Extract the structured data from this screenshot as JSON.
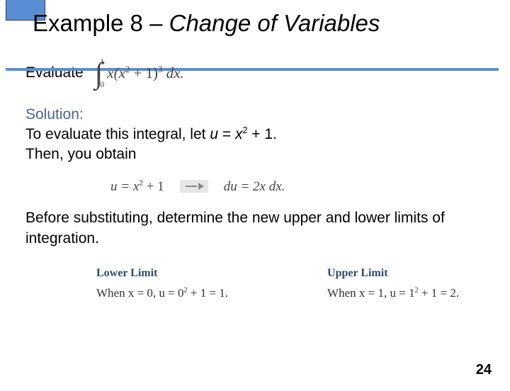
{
  "title": {
    "prefix": "Example 8 – ",
    "italic": "Change of Variables"
  },
  "evaluate_label": "Evaluate",
  "integral": {
    "lower": "0",
    "upper": "1",
    "expr": "x(x",
    "exp1": "2",
    "expr2": " + 1)",
    "exp2": "3",
    "expr3": " dx."
  },
  "solution_label": "Solution:",
  "solution_line1a": "To evaluate this integral, let ",
  "solution_u": "u",
  "solution_eq": " = ",
  "solution_x": "x",
  "solution_exp": "2",
  "solution_line1b": " + 1.",
  "solution_line2": "Then, you obtain",
  "sub_left_a": "u = x",
  "sub_left_exp": "2",
  "sub_left_b": " + 1",
  "sub_right_a": "du = 2x dx.",
  "before_text": "Before substituting, determine the new upper and lower limits of integration.",
  "limits": {
    "lower_head": "Lower Limit",
    "lower_body_a": "When x = 0,  u = 0",
    "lower_body_exp": "2",
    "lower_body_b": " + 1 = 1.",
    "upper_head": "Upper Limit",
    "upper_body_a": "When x = 1,  u = 1",
    "upper_body_exp": "2",
    "upper_body_b": " + 1 = 2."
  },
  "page_number": "24"
}
